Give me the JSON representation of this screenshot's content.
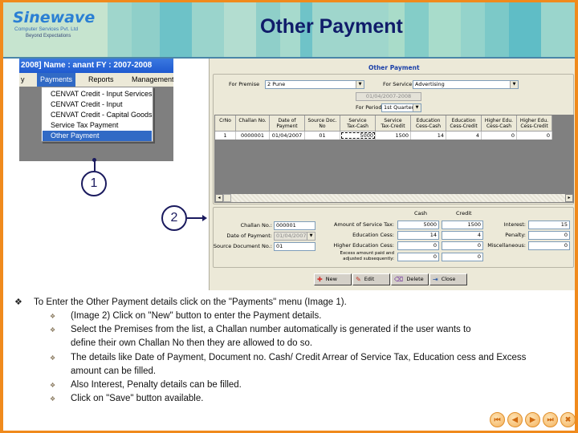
{
  "header": {
    "logo_name": "Sinewave",
    "logo_subtitle": "Computer Services Pvt. Ltd",
    "logo_tagline": "Beyond Expectations",
    "title": "Other Payment"
  },
  "image1": {
    "titlebar": "2008]   Name : anant    FY : 2007-2008",
    "menubar": [
      {
        "label": "y",
        "active": false
      },
      {
        "label": "Payments",
        "active": true
      },
      {
        "label": "Reports",
        "active": false
      },
      {
        "label": "Management",
        "active": false
      }
    ],
    "dropdown": [
      {
        "label": "CENVAT Credit - Input Services",
        "selected": false
      },
      {
        "label": "CENVAT Credit - Input",
        "selected": false
      },
      {
        "label": "CENVAT Credit - Capital Goods",
        "selected": false
      },
      {
        "label": "Service Tax Payment",
        "selected": false
      },
      {
        "label": "Other Payment",
        "selected": true
      }
    ]
  },
  "callouts": {
    "one": "1",
    "two": "2"
  },
  "image2": {
    "window_title": "Other Payment",
    "premises_label": "For Premise",
    "premises_value": "2        Pune",
    "service_label": "For Service",
    "service_value": "Advertising",
    "fy_value": "01/04/2007-2008",
    "period_label": "For Period:",
    "period_value": "1st Quarter",
    "grid": {
      "columns": [
        "CrNo",
        "Challan No.",
        "Date of\nPayment",
        "Source Doc.\nNo",
        "Service\nTax-Cash",
        "Service\nTax-Credit",
        "Education\nCess-Cash",
        "Education\nCess-Credit",
        "Higher Edu.\nCess-Cash",
        "Higher Edu.\nCess-Credit"
      ],
      "rows": [
        [
          "1",
          "0000001",
          "01/04/2007",
          "01",
          "5000",
          "1500",
          "14",
          "4",
          "0",
          "0"
        ]
      ]
    },
    "detail": {
      "challan_label": "Challan No.:",
      "challan_value": "000001",
      "date_label": "Date of Payment:",
      "date_value": "01/04/2007",
      "source_label": "Source Document No.:",
      "source_value": "01",
      "cash_header": "Cash",
      "credit_header": "Credit",
      "rows": [
        {
          "label": "Amount of Service Tax:",
          "cash": "5000",
          "credit": "1500"
        },
        {
          "label": "Education Cess:",
          "cash": "14",
          "credit": "4"
        },
        {
          "label": "Higher Education Cess:",
          "cash": "0",
          "credit": "0"
        },
        {
          "label": "Excess amount paid and\nadjusted subsequently:",
          "cash": "0",
          "credit": "0"
        }
      ],
      "interest_label": "Interest:",
      "interest_value": "15",
      "penalty_label": "Penalty:",
      "penalty_value": "0",
      "misc_label": "Miscellaneous:",
      "misc_value": "0"
    },
    "toolbar": {
      "new": "New",
      "edit": "Edit",
      "delete": "Delete",
      "close": "Close"
    }
  },
  "instructions": {
    "main": "To Enter the Other Payment details click on the \"Payments\" menu (Image 1).",
    "subs": [
      "(Image 2) Click on \"New\" button to enter the Payment details.",
      "Select the Premises from the list, a Challan number automatically is generated if the user wants to define their own Challan No then they are allowed to do so.",
      "The details like Date of Payment, Document no. Cash/ Credit Arrear of Service Tax, Education cess and Excess amount  can be filled.",
      "Also Interest, Penalty details can be filled.",
      "Click on \"Save\" button available."
    ]
  },
  "nav": {
    "first": "first-slide",
    "prev": "previous-slide",
    "next": "next-slide",
    "last": "last-slide",
    "close": "close-show"
  }
}
